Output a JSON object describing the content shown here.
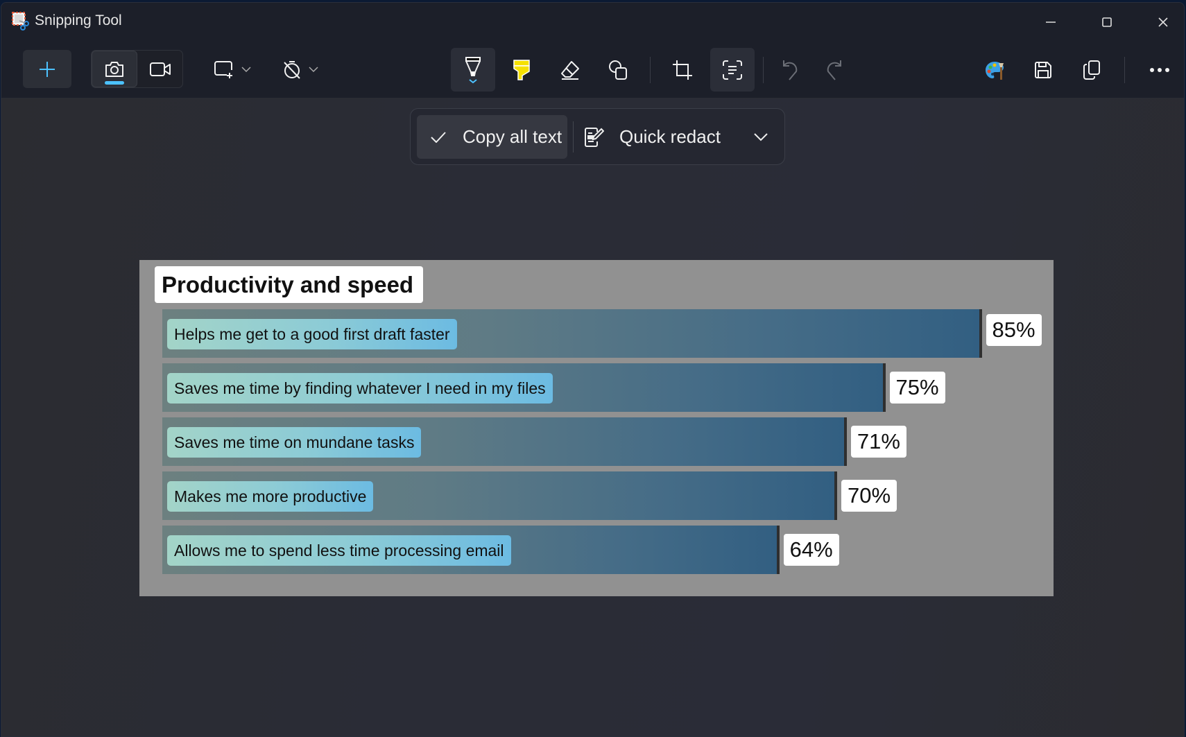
{
  "window": {
    "title": "Snipping Tool",
    "controls": [
      "minimize",
      "maximize",
      "close"
    ]
  },
  "toolbar": {
    "new_button": {
      "icon": "plus-icon",
      "label": "New"
    },
    "modes": [
      {
        "id": "screenshot",
        "icon": "camera-icon",
        "selected": true
      },
      {
        "id": "video",
        "icon": "video-camera-icon",
        "selected": false
      }
    ],
    "snip_shape": {
      "icon": "rectangle-snip-icon"
    },
    "delay": {
      "icon": "no-timer-icon"
    },
    "tools": [
      {
        "id": "pen",
        "icon": "ballpoint-pen-icon",
        "pressed": true
      },
      {
        "id": "highlighter",
        "icon": "highlighter-icon",
        "pressed": false
      },
      {
        "id": "eraser",
        "icon": "eraser-icon",
        "pressed": false
      },
      {
        "id": "shapes",
        "icon": "shapes-icon",
        "pressed": false
      },
      {
        "id": "crop",
        "icon": "crop-icon",
        "pressed": false
      },
      {
        "id": "text-actions",
        "icon": "text-actions-icon",
        "pressed": true
      }
    ],
    "history": [
      {
        "id": "undo",
        "icon": "undo-icon",
        "enabled": false
      },
      {
        "id": "redo",
        "icon": "redo-icon",
        "enabled": false
      }
    ],
    "right": [
      {
        "id": "edit-in-paint",
        "icon": "paint-palette-icon"
      },
      {
        "id": "save",
        "icon": "save-icon"
      },
      {
        "id": "copy",
        "icon": "copy-icon"
      },
      {
        "id": "more",
        "icon": "more-icon"
      }
    ],
    "accent_color": "#4cc2ff",
    "highlighter_color": "#f5e000"
  },
  "text_actions": {
    "copy_all_text": "Copy all text",
    "quick_redact": "Quick redact"
  },
  "chart_data": {
    "type": "bar",
    "orientation": "horizontal",
    "title": "Productivity and speed",
    "categories": [
      "Helps me get to a good first draft faster",
      "Saves me time by finding whatever I need in my files",
      "Saves me time on mundane tasks",
      "Makes me more productive",
      "Allows me to spend less time processing email"
    ],
    "values": [
      85,
      75,
      71,
      70,
      64
    ],
    "value_labels": [
      "85%",
      "75%",
      "71%",
      "70%",
      "64%"
    ],
    "unit": "%",
    "xlim": [
      0,
      100
    ],
    "xlabel": "",
    "ylabel": "",
    "grid": false,
    "legend": "none",
    "colors": {
      "bar_start": "#6c8080",
      "bar_end": "#325f82",
      "label_bg_start": "#a3d4c8",
      "label_bg_end": "#6cbbe2",
      "panel": "#919191"
    }
  }
}
